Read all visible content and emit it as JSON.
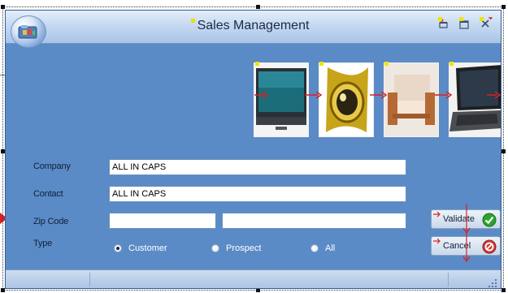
{
  "window": {
    "title": "Sales Management",
    "controls": [
      "restore-icon",
      "minimize-icon",
      "close-icon"
    ]
  },
  "images": [
    {
      "name": "tv-photo"
    },
    {
      "name": "watch-photo"
    },
    {
      "name": "armchair-photo"
    },
    {
      "name": "laptop-photo"
    }
  ],
  "form": {
    "company": {
      "label": "Company",
      "value": "ALL IN CAPS"
    },
    "contact": {
      "label": "Contact",
      "value": "ALL IN CAPS"
    },
    "zip": {
      "label": "Zip Code",
      "value1": "",
      "value2": ""
    },
    "type": {
      "label": "Type",
      "options": [
        {
          "label": "Customer",
          "checked": true
        },
        {
          "label": "Prospect",
          "checked": false
        },
        {
          "label": "All",
          "checked": false
        }
      ]
    }
  },
  "buttons": {
    "validate": {
      "label": "Validate",
      "icon": "green-check-icon"
    },
    "cancel": {
      "label": "Cancel",
      "icon": "red-cancel-icon"
    }
  },
  "colors": {
    "window_bg": "#5b8bc6",
    "titlebar": "#c6d9f1",
    "marker": "#d82020",
    "check": "#2aa52a"
  }
}
